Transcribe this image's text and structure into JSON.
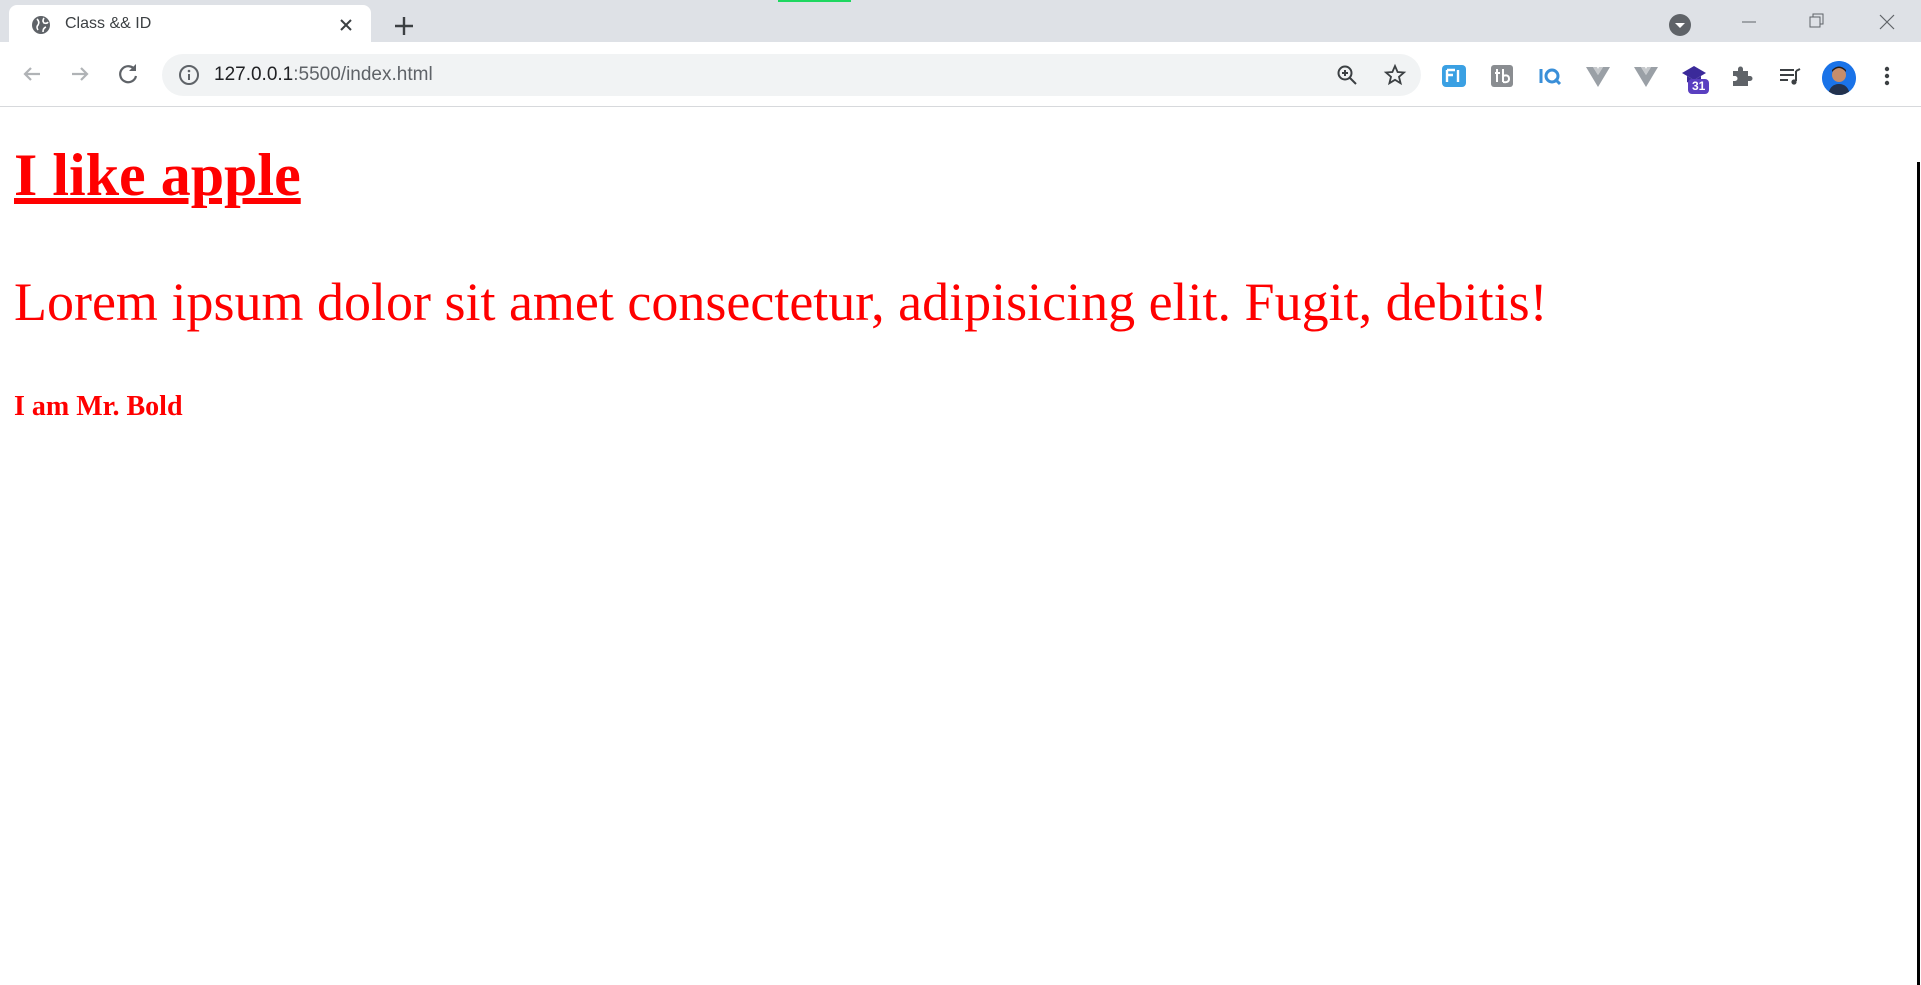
{
  "browser": {
    "tab_title": "Class && ID",
    "url_host": "127.0.0.1",
    "url_rest": ":5500/index.html",
    "extension_badge": "31"
  },
  "page": {
    "heading": "I like apple",
    "paragraph": "Lorem ipsum dolor sit amet consectetur, adipisicing elit. Fugit, debitis!",
    "bold_text": "I am Mr. Bold",
    "text_color": "#ff0000"
  },
  "colors": {
    "tabbar": "#dee1e6",
    "omnibox": "#f1f3f4",
    "loading": "#1ed760",
    "icon": "#5f6368"
  },
  "icons": [
    "globe-icon",
    "close-icon",
    "plus-icon",
    "tab-search-icon",
    "minimize-icon",
    "restore-icon",
    "window-close-icon",
    "back-icon",
    "forward-icon",
    "reload-icon",
    "info-icon",
    "zoom-icon",
    "star-icon",
    "extension-fi-icon",
    "extension-tb-icon",
    "extension-iq-icon",
    "extension-vue-icon",
    "extension-vue-devtools-icon",
    "extension-graduation-icon",
    "puzzle-icon",
    "media-control-icon",
    "avatar",
    "menu-icon"
  ]
}
